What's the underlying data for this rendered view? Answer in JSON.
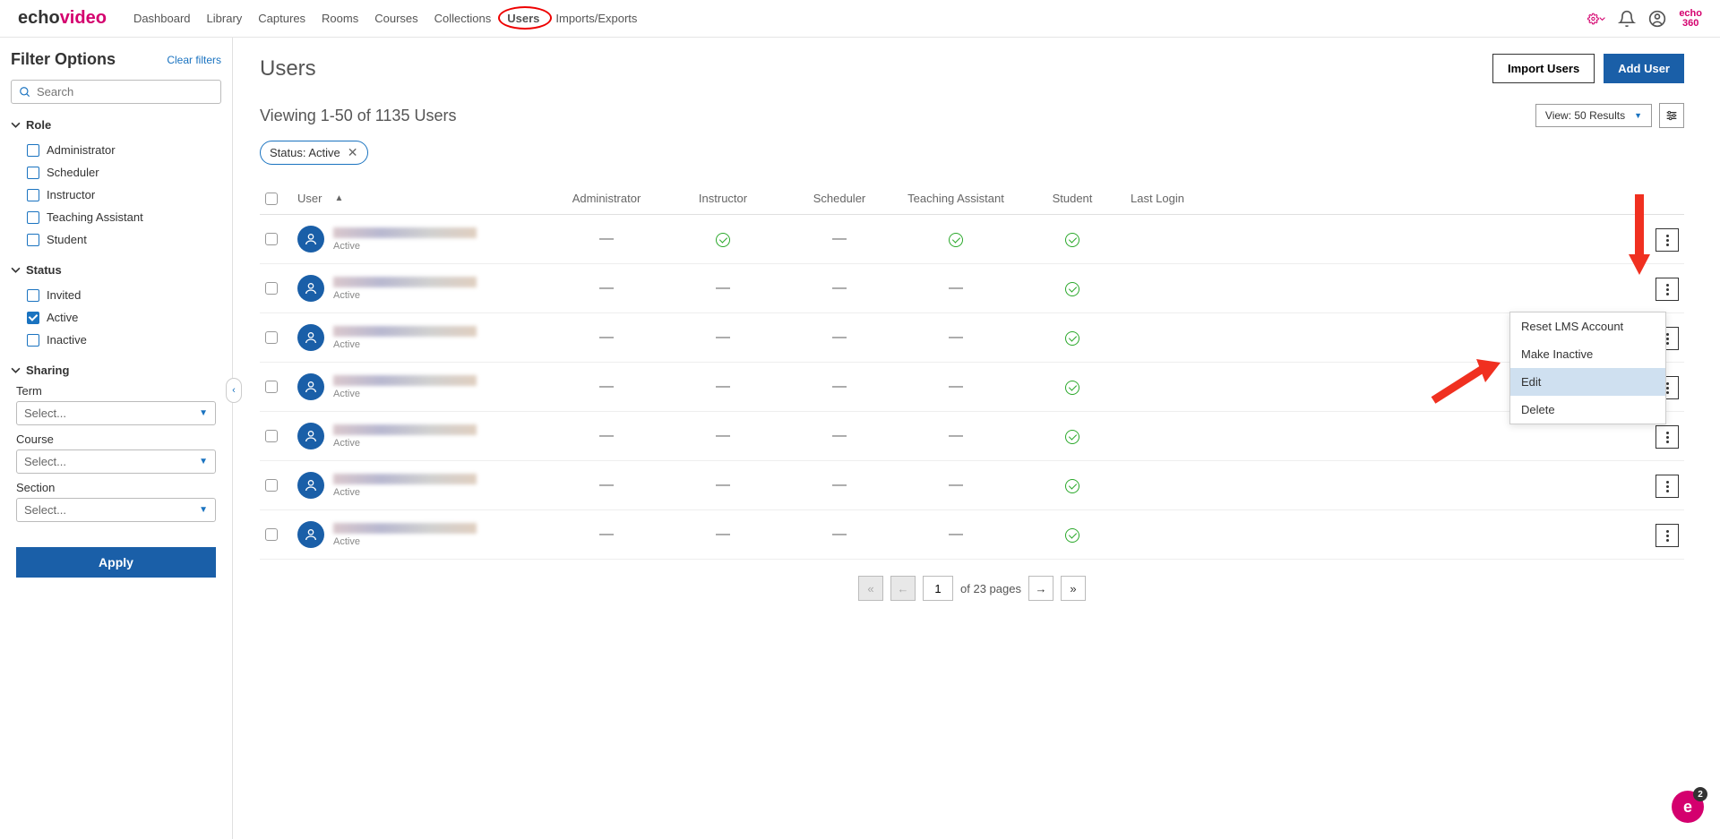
{
  "logo": {
    "echo": "echo",
    "video": "video"
  },
  "nav": [
    "Dashboard",
    "Library",
    "Captures",
    "Rooms",
    "Courses",
    "Collections",
    "Users",
    "Imports/Exports"
  ],
  "nav_active_index": 6,
  "echo360": {
    "line1": "echo",
    "line2": "360"
  },
  "sidebar": {
    "title": "Filter Options",
    "clear": "Clear filters",
    "search_placeholder": "Search",
    "role_label": "Role",
    "roles": [
      "Administrator",
      "Scheduler",
      "Instructor",
      "Teaching Assistant",
      "Student"
    ],
    "status_label": "Status",
    "statuses": [
      "Invited",
      "Active",
      "Inactive"
    ],
    "status_checked_index": 1,
    "sharing_label": "Sharing",
    "term_label": "Term",
    "course_label": "Course",
    "section_label": "Section",
    "select_placeholder": "Select...",
    "apply": "Apply"
  },
  "page": {
    "title": "Users",
    "import": "Import Users",
    "add": "Add User",
    "viewing": "Viewing 1-50 of 1135 Users",
    "view_dropdown": "View: 50 Results",
    "filter_chip": "Status: Active"
  },
  "table": {
    "headers": {
      "user": "User",
      "admin": "Administrator",
      "instructor": "Instructor",
      "scheduler": "Scheduler",
      "ta": "Teaching Assistant",
      "student": "Student",
      "login": "Last Login"
    },
    "rows": [
      {
        "status": "Active",
        "admin": "dash",
        "instructor": "check",
        "scheduler": "dash",
        "ta": "check",
        "student": "check"
      },
      {
        "status": "Active",
        "admin": "dash",
        "instructor": "dash",
        "scheduler": "dash",
        "ta": "dash",
        "student": "check"
      },
      {
        "status": "Active",
        "admin": "dash",
        "instructor": "dash",
        "scheduler": "dash",
        "ta": "dash",
        "student": "check"
      },
      {
        "status": "Active",
        "admin": "dash",
        "instructor": "dash",
        "scheduler": "dash",
        "ta": "dash",
        "student": "check"
      },
      {
        "status": "Active",
        "admin": "dash",
        "instructor": "dash",
        "scheduler": "dash",
        "ta": "dash",
        "student": "check"
      },
      {
        "status": "Active",
        "admin": "dash",
        "instructor": "dash",
        "scheduler": "dash",
        "ta": "dash",
        "student": "check"
      },
      {
        "status": "Active",
        "admin": "dash",
        "instructor": "dash",
        "scheduler": "dash",
        "ta": "dash",
        "student": "check"
      }
    ]
  },
  "menu": {
    "items": [
      "Reset LMS Account",
      "Make Inactive",
      "Edit",
      "Delete"
    ],
    "highlighted_index": 2
  },
  "pagination": {
    "current": "1",
    "label": "of 23 pages"
  },
  "badge_count": "2"
}
